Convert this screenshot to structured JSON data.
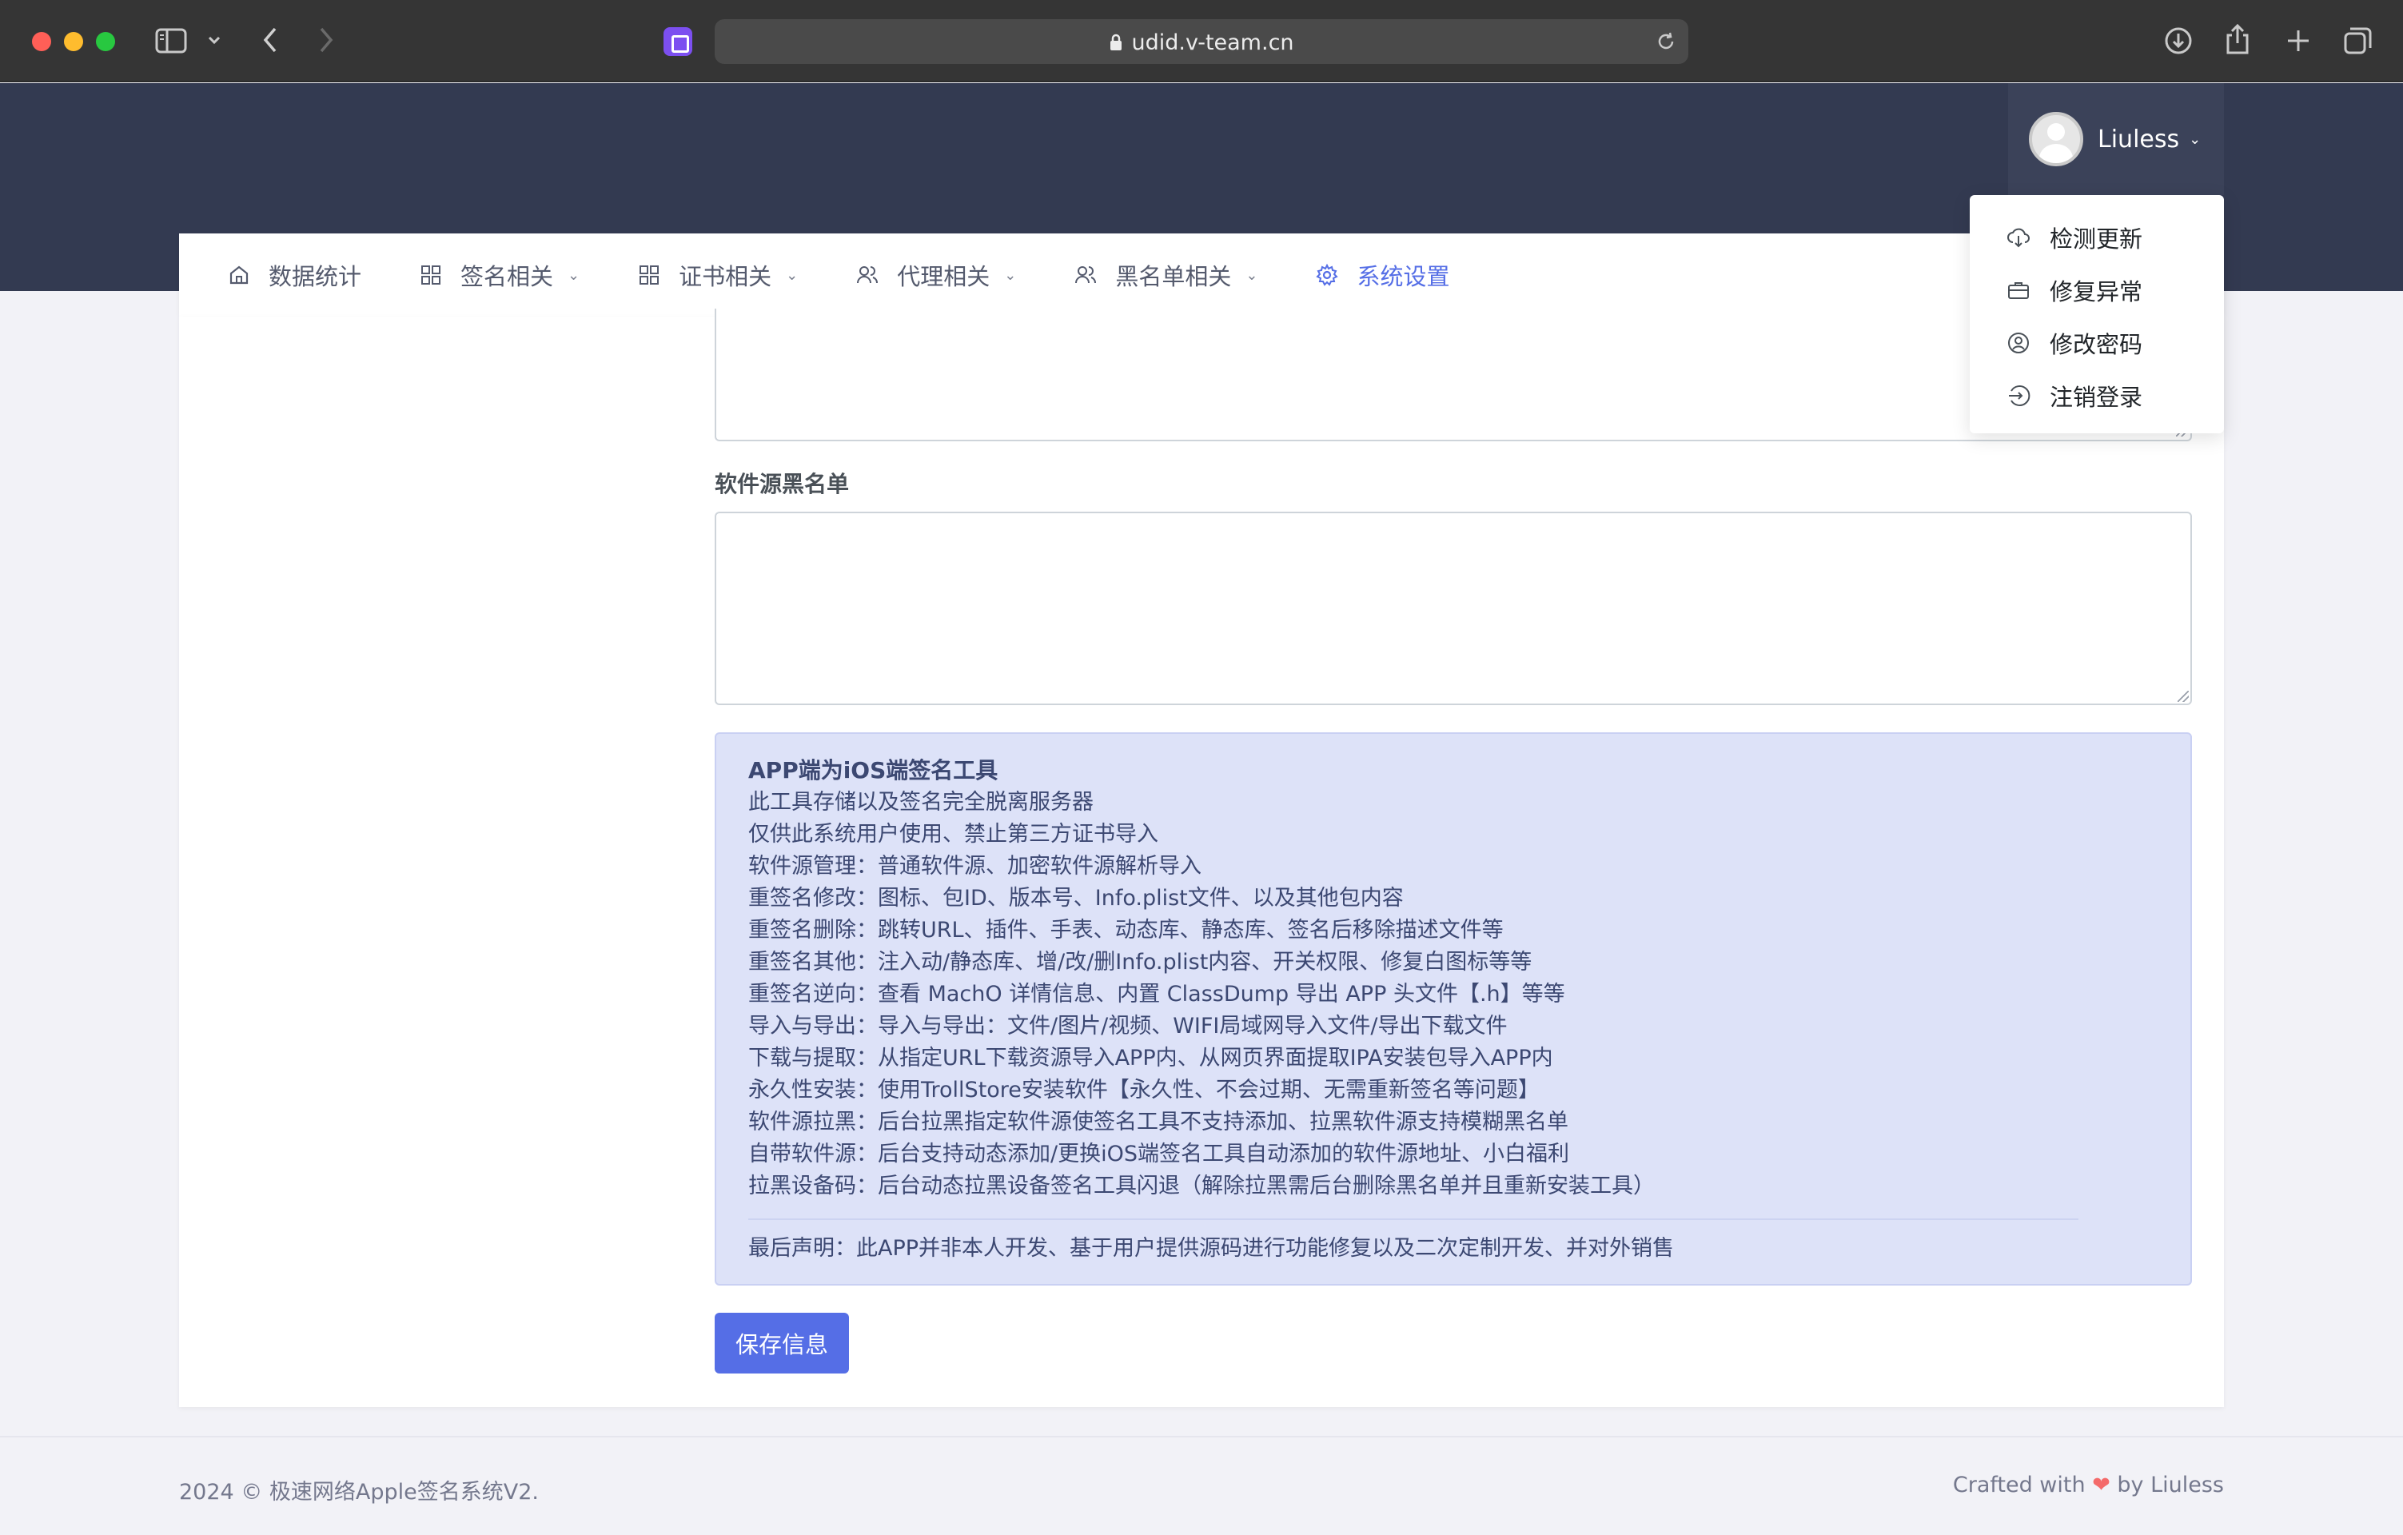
{
  "browser": {
    "url": "udid.v-team.cn"
  },
  "header": {
    "username": "Liuless",
    "caret": "⌄"
  },
  "nav": {
    "items": [
      {
        "label": "数据统计",
        "icon": "home-icon"
      },
      {
        "label": "签名相关",
        "icon": "grid-icon"
      },
      {
        "label": "证书相关",
        "icon": "grid-icon"
      },
      {
        "label": "代理相关",
        "icon": "users-icon"
      },
      {
        "label": "黑名单相关",
        "icon": "users-icon"
      },
      {
        "label": "系统设置",
        "icon": "gear-icon",
        "active": true
      }
    ],
    "caret": "⌄"
  },
  "dropdown": {
    "items": [
      {
        "label": "检测更新",
        "icon": "cloud-download-icon"
      },
      {
        "label": "修复异常",
        "icon": "briefcase-icon"
      },
      {
        "label": "修改密码",
        "icon": "user-circle-icon"
      },
      {
        "label": "注销登录",
        "icon": "logout-icon"
      }
    ]
  },
  "form": {
    "blacklist_label": "软件源黑名单",
    "blacklist_value": "",
    "save_label": "保存信息"
  },
  "info": {
    "title": "APP端为iOS端签名工具",
    "lines": [
      "此工具存储以及签名完全脱离服务器",
      "仅供此系统用户使用、禁止第三方证书导入",
      "软件源管理：普通软件源、加密软件源解析导入",
      "重签名修改：图标、包ID、版本号、Info.plist文件、以及其他包内容",
      "重签名删除：跳转URL、插件、手表、动态库、静态库、签名后移除描述文件等",
      "重签名其他：注入动/静态库、增/改/删Info.plist内容、开关权限、修复白图标等等",
      "重签名逆向：查看 MachO 详情信息、内置 ClassDump 导出 APP 头文件【.h】等等",
      "导入与导出：导入与导出：文件/图片/视频、WIFI局域网导入文件/导出下载文件",
      "下载与提取：从指定URL下载资源导入APP内、从网页界面提取IPA安装包导入APP内",
      "永久性安装：使用TrollStore安装软件【永久性、不会过期、无需重新签名等问题】",
      "软件源拉黑：后台拉黑指定软件源使签名工具不支持添加、拉黑软件源支持模糊黑名单",
      "自带软件源：后台支持动态添加/更换iOS端签名工具自动添加的软件源地址、小白福利",
      "拉黑设备码：后台动态拉黑设备签名工具闪退（解除拉黑需后台删除黑名单并且重新安装工具）"
    ],
    "footer_note": "最后声明：此APP并非本人开发、基于用户提供源码进行功能修复以及二次定制开发、并对外销售"
  },
  "footer": {
    "copyright": "2024 © 极速网络Apple签名系统V2.",
    "crafted_prefix": "Crafted with ",
    "heart": "❤",
    "crafted_suffix": " by Liuless"
  },
  "colors": {
    "topbar": "#333a51",
    "accent": "#556ee6",
    "info_bg": "#dde2f8"
  }
}
